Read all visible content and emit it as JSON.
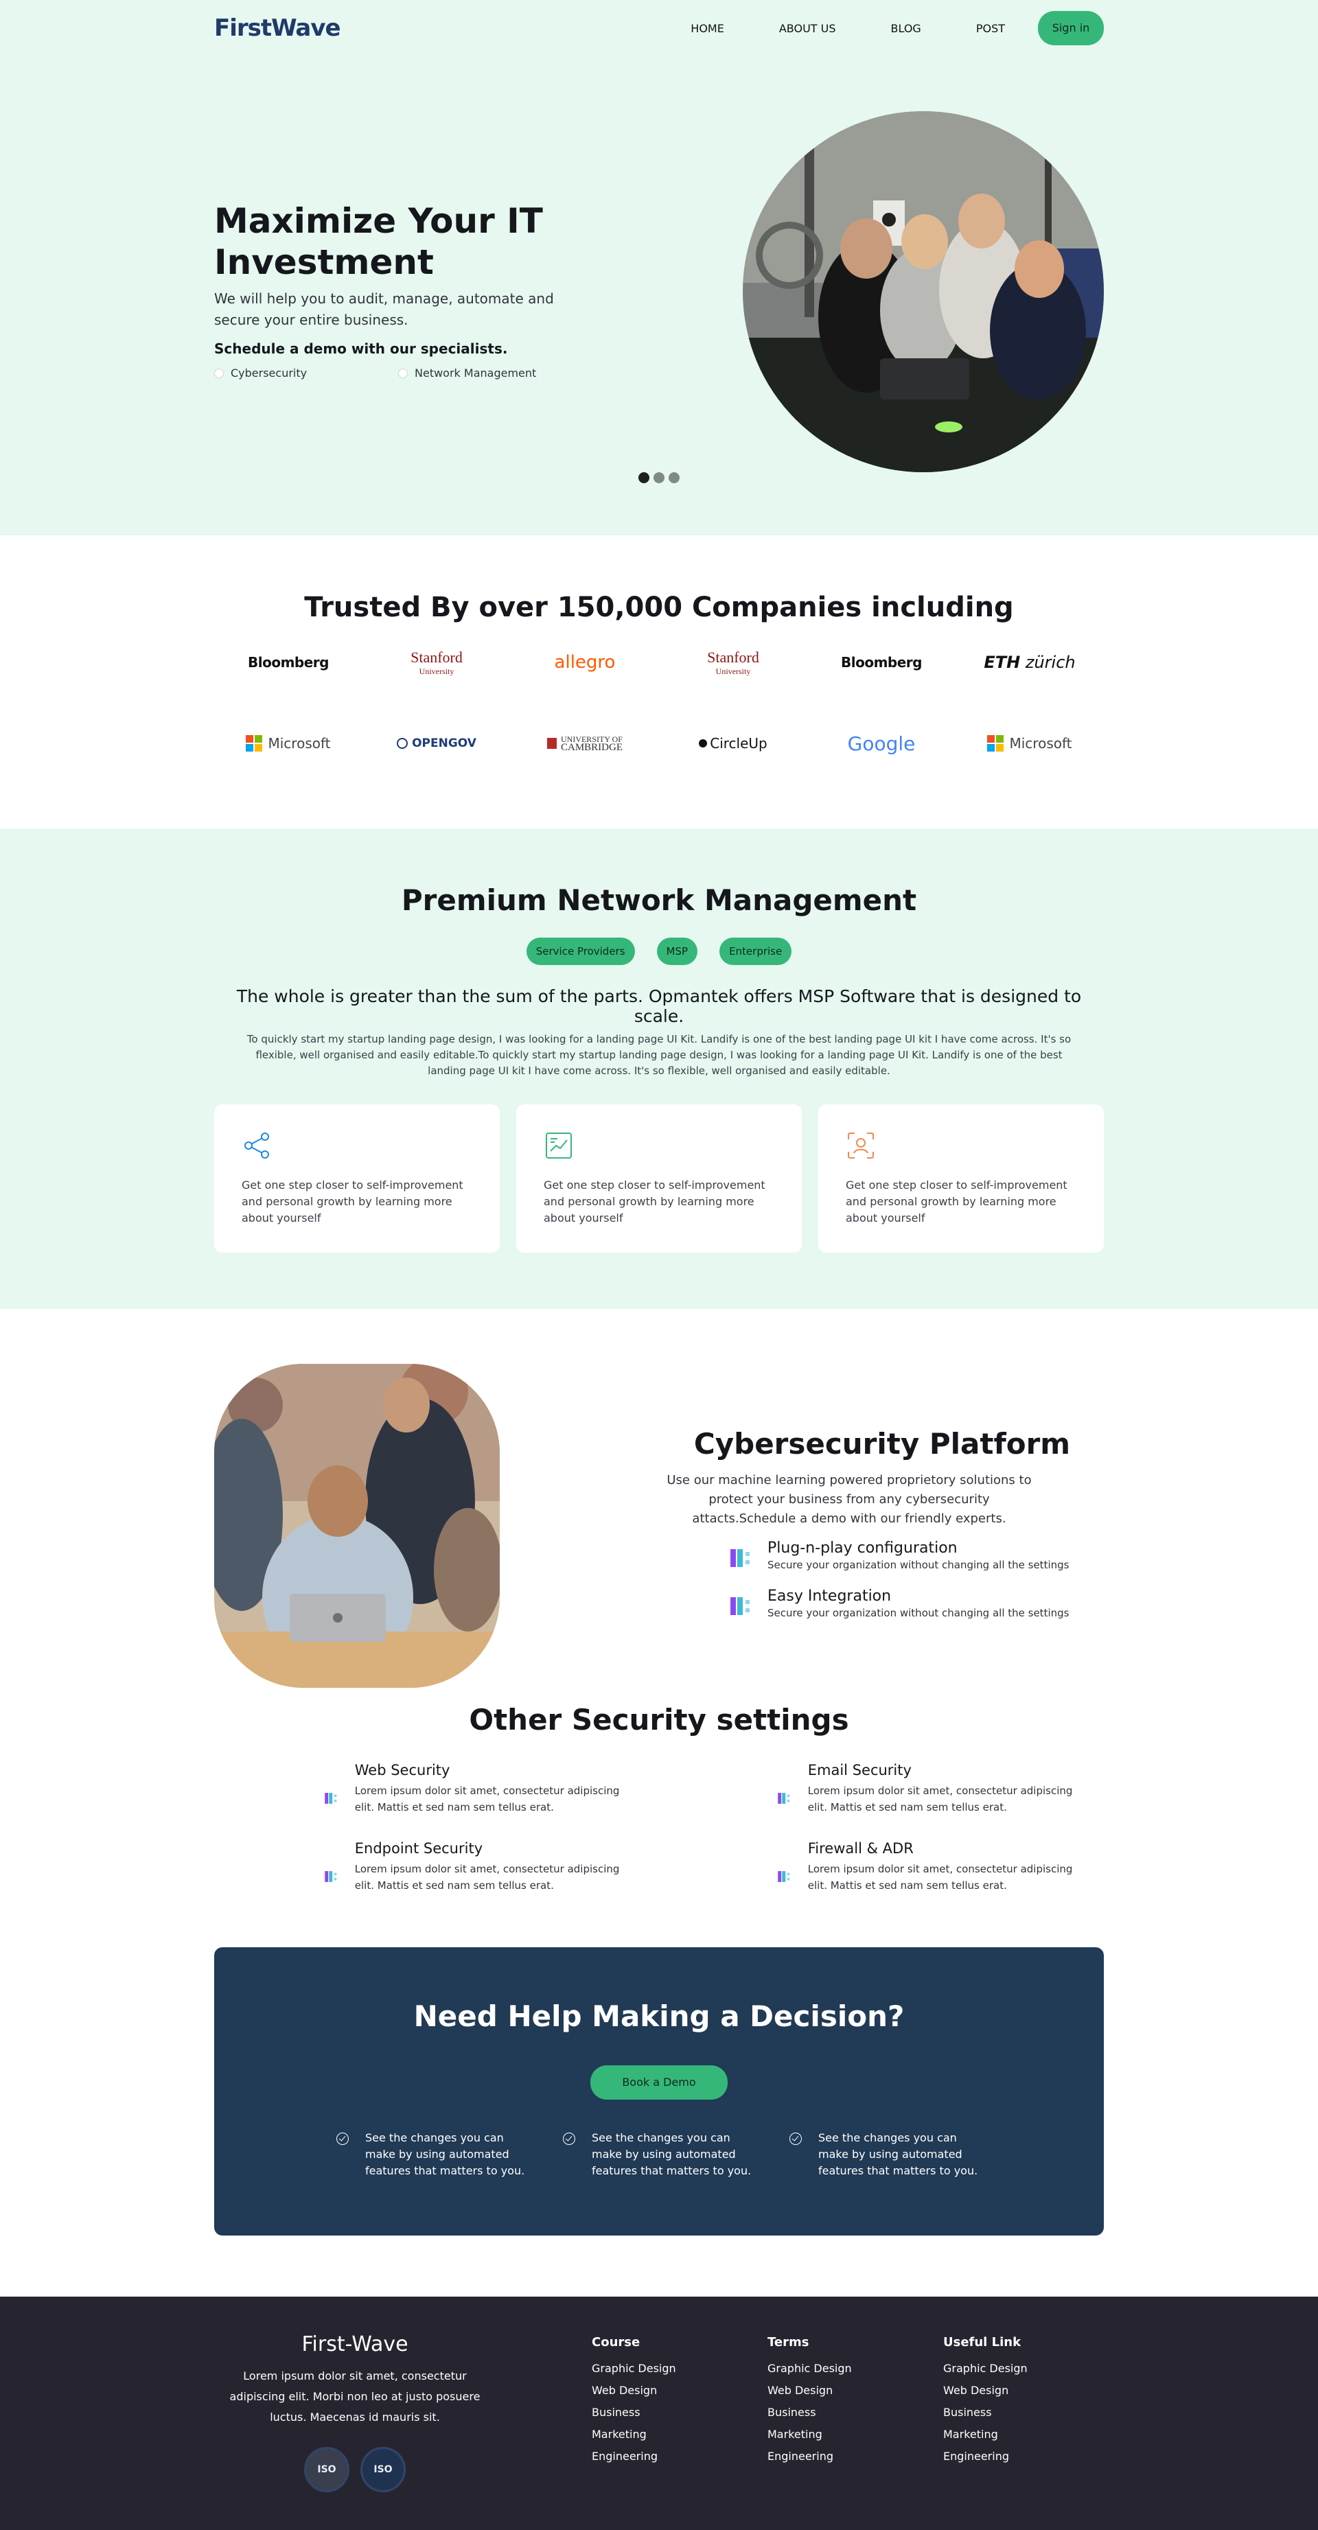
{
  "brand": "FirstWave",
  "nav": {
    "items": [
      "HOME",
      "ABOUT US",
      "BLOG",
      "POST"
    ],
    "signin": "Sign in"
  },
  "hero": {
    "title": "Maximize Your IT Investment",
    "subtitle": "We will help you to audit, manage, automate and secure your entire business.",
    "cta": "Schedule a demo with our specialists.",
    "options": [
      "Cybersecurity",
      "Network Management"
    ],
    "slider_active": 1,
    "slider_count": 3
  },
  "trusted": {
    "title": "Trusted By over 150,000 Companies including",
    "logos": {
      "bloomberg": "Bloomberg",
      "stanford": "Stanford",
      "stanford_sub": "University",
      "allegro": "allegro",
      "eth_a": "ETH",
      "eth_b": "zürich",
      "microsoft": "Microsoft",
      "opengov": "OPENGOV",
      "cambridge_a": "UNIVERSITY OF",
      "cambridge_b": "CAMBRIDGE",
      "circleup": "CircleUp",
      "google": "Google"
    },
    "colors": {
      "ms_red": "#f25022",
      "ms_green": "#7fba00",
      "ms_blue": "#00a4ef",
      "ms_yellow": "#ffb900"
    }
  },
  "premium": {
    "title": "Premium Network Management",
    "pills": [
      "Service Providers",
      "MSP",
      "Enterprise"
    ],
    "lead": "The whole is greater than the sum of the parts. Opmantek offers MSP Software that is designed to scale.",
    "body": "To quickly start my startup landing page design, I was looking for a landing page UI Kit. Landify is one of the best landing page UI kit I have come across. It's so flexible, well organised and easily editable.To quickly start my startup landing page design, I was looking for a landing page UI Kit. Landify is one of the best landing page UI kit I have come across. It's so flexible, well organised and easily editable.",
    "cards": [
      {
        "icon": "share-icon",
        "text": "Get one step closer to self-improvement and personal growth by learning more about yourself"
      },
      {
        "icon": "chart-icon",
        "text": "Get one step closer to self-improvement and personal growth by learning more about yourself"
      },
      {
        "icon": "face-scan-icon",
        "text": "Get one step closer to self-improvement and personal growth by learning more about yourself"
      }
    ]
  },
  "cyber": {
    "title": "Cybersecurity Platform",
    "subtitle": "Use our machine learning powered proprietory solutions to protect your business from any cybersecurity attacts.Schedule a demo with our friendly experts.",
    "features": [
      {
        "title": "Plug-n-play configuration",
        "text": "Secure your organization without changing all the settings"
      },
      {
        "title": "Easy Integration",
        "text": "Secure your organization without changing all the settings"
      }
    ]
  },
  "other": {
    "title": "Other Security settings",
    "items": [
      {
        "title": "Web Security",
        "text": "Lorem ipsum dolor sit amet, consectetur adipiscing elit. Mattis et sed nam sem tellus erat."
      },
      {
        "title": "Email Security",
        "text": "Lorem ipsum dolor sit amet, consectetur adipiscing elit. Mattis et sed nam sem tellus erat."
      },
      {
        "title": "Endpoint Security",
        "text": "Lorem ipsum dolor sit amet, consectetur adipiscing elit. Mattis et sed nam sem tellus erat."
      },
      {
        "title": "Firewall & ADR",
        "text": "Lorem ipsum dolor sit amet, consectetur adipiscing elit. Mattis et sed nam sem tellus erat."
      }
    ]
  },
  "help": {
    "title": "Need Help Making a Decision?",
    "button": "Book a Demo",
    "checks": [
      "See the changes you can make by using automated features that matters to you.",
      "See the changes you can make by using automated features that matters to you.",
      "See the changes you can make by using automated features that matters to you."
    ]
  },
  "footer": {
    "brand": "First-Wave",
    "text": "Lorem ipsum dolor sit amet, consectetur adipiscing elit. Morbi non leo at justo posuere luctus. Maecenas id mauris sit.",
    "badges": [
      "ISO",
      "ISO"
    ],
    "columns": [
      {
        "title": "Course",
        "links": [
          "Graphic Design",
          "Web Design",
          "Business",
          "Marketing",
          "Engineering"
        ]
      },
      {
        "title": "Terms",
        "links": [
          "Graphic Design",
          "Web Design",
          "Business",
          "Marketing",
          "Engineering"
        ]
      },
      {
        "title": "Useful Link",
        "links": [
          "Graphic Design",
          "Web Design",
          "Business",
          "Marketing",
          "Engineering"
        ]
      }
    ]
  },
  "colors": {
    "accent": "#36b77a",
    "mint_bg": "#e6f8ef",
    "navy": "#213a55",
    "footer_bg": "#26252f",
    "brand": "#1f3a6b"
  }
}
